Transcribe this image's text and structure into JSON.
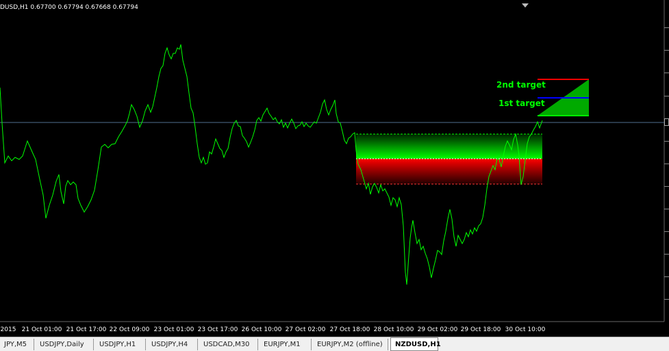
{
  "chart": {
    "symbol_info": "DUSD,H1  0.67700 0.67794 0.67668 0.67794",
    "colors": {
      "background": "#000000",
      "price_line": "#00ff00",
      "hline": "#4f6f8f",
      "text": "#ffffff",
      "target_text": "#00ff00",
      "zone_green": "#00cc00",
      "zone_red": "#dd0000",
      "target_red_line": "#ff0000",
      "target_blue_line": "#0000ff"
    },
    "x_labels": [
      "2015",
      "21 Oct 01:00",
      "21 Oct 17:00",
      "22 Oct 09:00",
      "23 Oct 01:00",
      "23 Oct 17:00",
      "26 Oct 10:00",
      "27 Oct 02:00",
      "27 Oct 18:00",
      "28 Oct 10:00",
      "29 Oct 02:00",
      "29 Oct 18:00",
      "30 Oct 10:00"
    ],
    "targets": {
      "second": "2nd target",
      "first": "1st target"
    },
    "scroll_icon": "shift-arrow-down-icon"
  },
  "tabs": [
    {
      "label": "JPY,M5",
      "active": false
    },
    {
      "label": "USDJPY,Daily",
      "active": false
    },
    {
      "label": "USDJPY,H1",
      "active": false
    },
    {
      "label": "USDJPY,H4",
      "active": false
    },
    {
      "label": "USDCAD,M30",
      "active": false
    },
    {
      "label": "EURJPY,M1",
      "active": false
    },
    {
      "label": "EURJPY,M2 (offline)",
      "active": false
    },
    {
      "label": "NZDUSD,H1",
      "active": true
    }
  ]
}
